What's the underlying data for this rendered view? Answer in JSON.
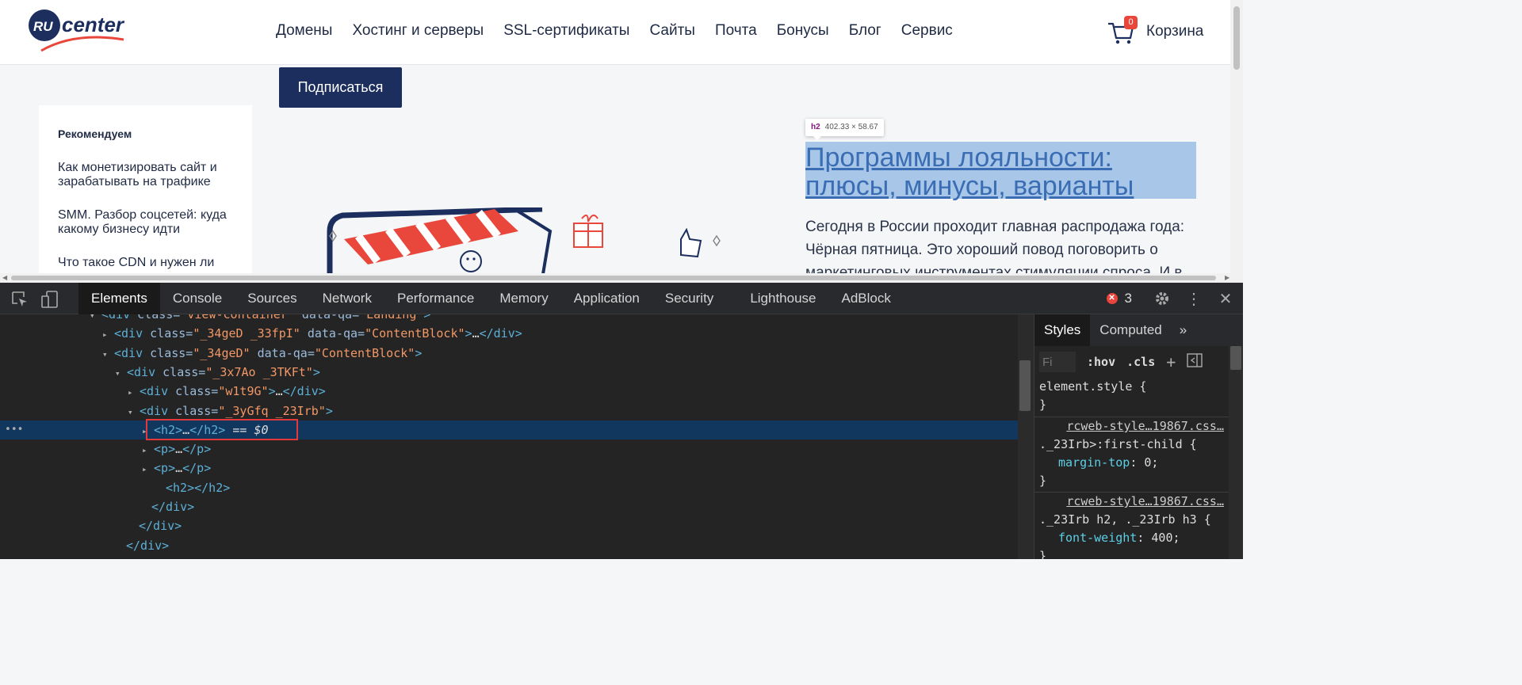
{
  "site": {
    "logo_text_ru": "RU",
    "logo_text_center": "center",
    "nav": [
      "Домены",
      "Хостинг и серверы",
      "SSL-сертификаты",
      "Сайты",
      "Почта",
      "Бонусы",
      "Блог",
      "Сервис"
    ],
    "cart_count": "0",
    "cart_label": "Корзина",
    "subscribe_label": "Подписаться",
    "sidebar_heading": "Рекомендуем",
    "sidebar_links": [
      "Как монетизировать сайт и зарабатывать на трафике",
      "SMM. Разбор соцсетей: куда какому бизнесу идти",
      "Что такое CDN и нужен ли"
    ],
    "tooltip_tag": "h2",
    "tooltip_size": "402.33 × 58.67",
    "article_title": "Программы лояльности: плюсы, минусы, варианты",
    "article_text": "Сегодня в России проходит главная распродажа года: Чёрная пятница. Это хороший повод поговорить о маркетинговых инструментах стимуляции спроса. И в"
  },
  "devtools": {
    "tabs": [
      "Elements",
      "Console",
      "Sources",
      "Network",
      "Performance",
      "Memory",
      "Application",
      "Security",
      "Lighthouse",
      "AdBlock"
    ],
    "active_tab": "Elements",
    "error_count": "3",
    "dom_lines": [
      {
        "indent": 128,
        "tri": "▾",
        "tag_open": "<div",
        "attr": " class=",
        "val": "\"view-container\"",
        "attr2": " data-qa=",
        "val2": "\"Landing\"",
        "close": ">",
        "txt": ""
      },
      {
        "indent": 144,
        "tri": "▸",
        "tag_open": "<div",
        "attr": " class=",
        "val": "\"_34geD _33fpI\"",
        "attr2": " data-qa=",
        "val2": "\"ContentBlock\"",
        "close": ">",
        "txt": "…</div>"
      },
      {
        "indent": 144,
        "tri": "▾",
        "tag_open": "<div",
        "attr": " class=",
        "val": "\"_34geD\"",
        "attr2": " data-qa=",
        "val2": "\"ContentBlock\"",
        "close": ">",
        "txt": ""
      },
      {
        "indent": 160,
        "tri": "▾",
        "tag_open": "<div",
        "attr": " class=",
        "val": "\"_3x7Ao _3TKFt\"",
        "attr2": "",
        "val2": "",
        "close": ">",
        "txt": ""
      },
      {
        "indent": 176,
        "tri": "▸",
        "tag_open": "<div",
        "attr": " class=",
        "val": "\"w1t9G\"",
        "attr2": "",
        "val2": "",
        "close": ">",
        "txt": "…</div>"
      },
      {
        "indent": 176,
        "tri": "▾",
        "tag_open": "<div",
        "attr": " class=",
        "val": "\"_3yGfq _23Irb\"",
        "attr2": "",
        "val2": "",
        "close": ">",
        "txt": ""
      },
      {
        "indent": 194,
        "tri": "▸",
        "tag_open": "<h2",
        "attr": "",
        "val": "",
        "attr2": "",
        "val2": "",
        "close": ">",
        "txt": "…</h2>",
        "selected": true
      },
      {
        "indent": 194,
        "tri": "▸",
        "tag_open": "<p",
        "attr": "",
        "val": "",
        "attr2": "",
        "val2": "",
        "close": ">",
        "txt": "…</p>"
      },
      {
        "indent": 194,
        "tri": "▸",
        "tag_open": "<p",
        "attr": "",
        "val": "",
        "attr2": "",
        "val2": "",
        "close": ">",
        "txt": "…</p>"
      },
      {
        "indent": 194,
        "tri": "",
        "tag_open": "<h2",
        "attr": "",
        "val": "",
        "attr2": "",
        "val2": "",
        "close": ">",
        "txt": "</h2>"
      },
      {
        "indent": 176,
        "tri": "",
        "tag_open": "</div",
        "attr": "",
        "val": "",
        "attr2": "",
        "val2": "",
        "close": ">",
        "txt": ""
      },
      {
        "indent": 160,
        "tri": "",
        "tag_open": "</div",
        "attr": "",
        "val": "",
        "attr2": "",
        "val2": "",
        "close": ">",
        "txt": ""
      },
      {
        "indent": 144,
        "tri": "",
        "tag_open": "</div",
        "attr": "",
        "val": "",
        "attr2": "",
        "val2": "",
        "close": ">",
        "txt": ""
      }
    ],
    "selected_suffix": " == ",
    "selected_dollar": "$0",
    "styles_tabs": [
      "Styles",
      "Computed",
      "»"
    ],
    "filter_placeholder": "Fi",
    "hov": ":hov",
    "cls": ".cls",
    "rules": [
      {
        "source": "",
        "selector": "element.style {",
        "prop": "",
        "value": "",
        "close": "}"
      },
      {
        "source": "rcweb-style…19867.css…",
        "selector": "._23Irb>:first-child {",
        "prop": "margin-top",
        "value": "0;",
        "close": "}"
      },
      {
        "source": "rcweb-style…19867.css…",
        "selector": "._23Irb h2, ._23Irb h3 {",
        "prop": "font-weight",
        "value": "400;",
        "close": "}"
      }
    ]
  }
}
